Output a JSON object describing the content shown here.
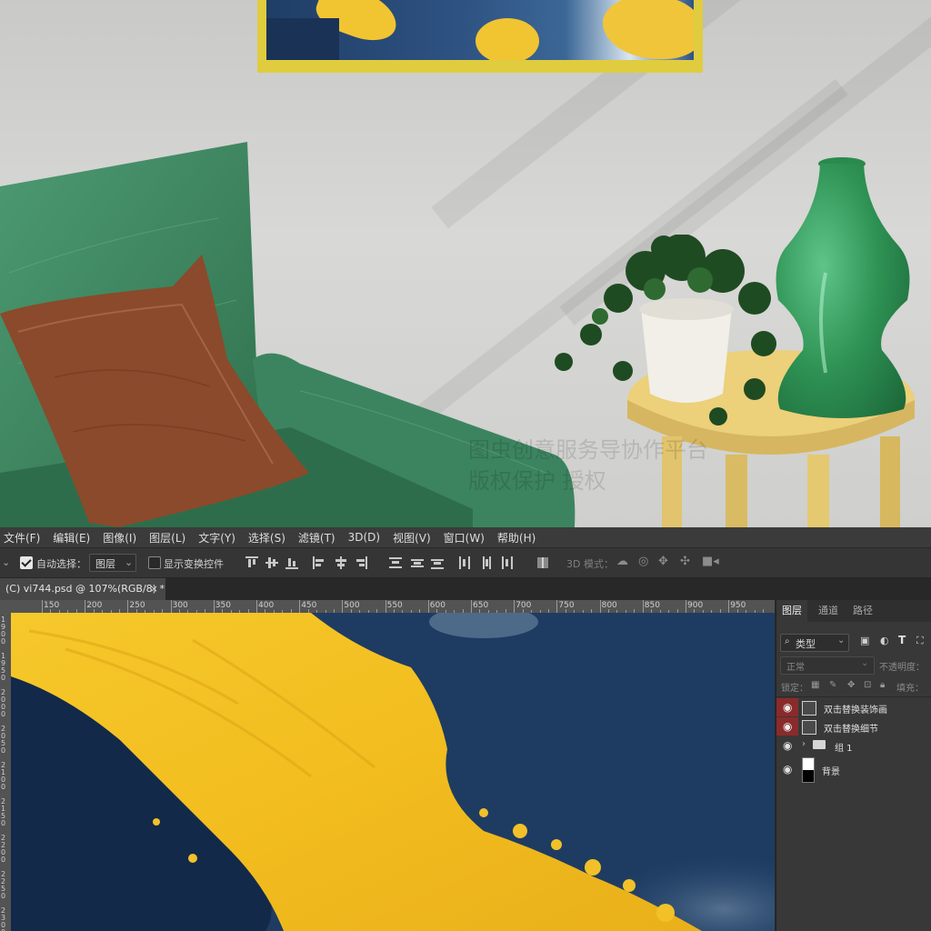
{
  "menu": [
    "文件(F)",
    "编辑(E)",
    "图像(I)",
    "图层(L)",
    "文字(Y)",
    "选择(S)",
    "滤镜(T)",
    "3D(D)",
    "视图(V)",
    "窗口(W)",
    "帮助(H)"
  ],
  "options": {
    "auto_select_label": "自动选择：",
    "auto_select_value": "图层",
    "show_transform_label": "显示变换控件",
    "mode_3d_label": "3D 模式："
  },
  "document_tab": {
    "title": "(C) vi744.psd @ 107%(RGB/8) *",
    "close": "×"
  },
  "ruler_h_labels": [
    "150",
    "200",
    "250",
    "300",
    "350",
    "400",
    "450",
    "500",
    "550",
    "600",
    "650",
    "700",
    "750",
    "800",
    "850",
    "900",
    "950"
  ],
  "ruler_v_labels": [
    "1900",
    "1950",
    "2000",
    "2050",
    "2100",
    "2150",
    "2200",
    "2250",
    "2300"
  ],
  "layers_panel": {
    "tabs": [
      "图层",
      "通道",
      "路径"
    ],
    "filter_label": "类型",
    "blend_mode": "正常",
    "opacity_label": "不透明度：",
    "lock_label": "锁定：",
    "fill_label": "填充：",
    "layers": [
      {
        "name": "双击替换装饰画",
        "kind": "smart",
        "highlight": true
      },
      {
        "name": "双击替换细节",
        "kind": "smart",
        "highlight": true
      },
      {
        "name": "组 1",
        "kind": "group",
        "highlight": false
      },
      {
        "name": "背景",
        "kind": "background",
        "highlight": false
      }
    ]
  },
  "watermark_lines": [
    "图虫创意服务导协作平台",
    "版权保护   授权"
  ],
  "colors": {
    "sofa_green": "#3f8a63",
    "pillow_brown": "#8e4a2c",
    "vase_green": "#2f9455",
    "table_yellow": "#e8c96c",
    "frame_yellow": "#e0cc3f",
    "navy": "#1a355a",
    "gold": "#f3c428",
    "eye_highlight": "#8a2b2b"
  }
}
